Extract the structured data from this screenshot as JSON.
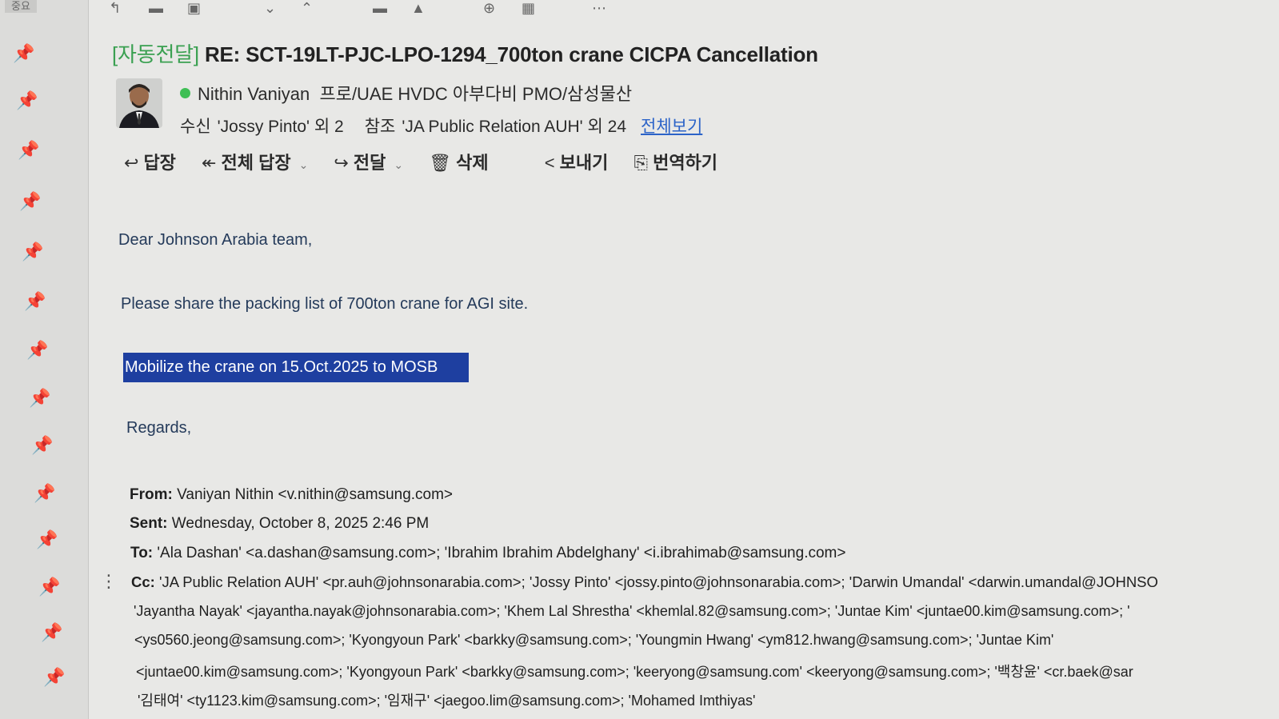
{
  "sidebar": {
    "top_label": "중요",
    "pin_count": 14
  },
  "toolbar_top": {
    "icons": [
      "back-arrow-icon",
      "archive-icon",
      "move-icon",
      "dropdown-icon",
      "up-icon",
      "mail-icon",
      "bell-icon",
      "zoom-icon",
      "grid-icon",
      "more-icon"
    ]
  },
  "email": {
    "subject_tag": "[자동전달]",
    "subject": "RE: SCT-19LT-PJC-LPO-1294_700ton crane CICPA Cancellation",
    "sender": "Nithin Vaniyan",
    "sender_org": "프로/UAE HVDC 아부다비 PMO/삼성물산",
    "to_label": "수신",
    "to_value": "'Jossy Pinto' 외 2",
    "cc_label": "참조",
    "cc_value": "'JA Public Relation AUH' 외 24",
    "view_all": "전체보기"
  },
  "actions": {
    "reply": "답장",
    "reply_all": "전체 답장",
    "forward": "전달",
    "delete": "삭제",
    "share": "보내기",
    "translate": "번역하기"
  },
  "body": {
    "greeting": "Dear Johnson Arabia team,",
    "line1": "Please share the packing list of 700ton crane for AGI site.",
    "highlight": "Mobilize the crane on 15.Oct.2025 to MOSB",
    "regards": "Regards,"
  },
  "quoted": {
    "from_label": "From:",
    "from_value": "Vaniyan Nithin <v.nithin@samsung.com>",
    "sent_label": "Sent:",
    "sent_value": "Wednesday, October 8, 2025 2:46 PM",
    "to_label": "To:",
    "to_value": "'Ala Dashan' <a.dashan@samsung.com>; 'Ibrahim Ibrahim Abdelghany' <i.ibrahimab@samsung.com>",
    "cc_label": "Cc:",
    "cc_line1": "'JA Public Relation AUH' <pr.auh@johnsonarabia.com>; 'Jossy Pinto' <jossy.pinto@johnsonarabia.com>; 'Darwin Umandal' <darwin.umandal@JOHNSO",
    "cc_line2": "'Jayantha Nayak' <jayantha.nayak@johnsonarabia.com>; 'Khem Lal Shrestha' <khemlal.82@samsung.com>; 'Juntae Kim' <juntae00.kim@samsung.com>; '",
    "cc_line3": "<ys0560.jeong@samsung.com>; 'Kyongyoun Park' <barkky@samsung.com>; 'Youngmin Hwang' <ym812.hwang@samsung.com>; 'Juntae Kim'",
    "cc_line4": "<juntae00.kim@samsung.com>; 'Kyongyoun Park' <barkky@samsung.com>; 'keeryong@samsung.com' <keeryong@samsung.com>; '백창윤' <cr.baek@sar",
    "cc_line5": "'김태여' <ty1123.kim@samsung.com>; '임재구' <jaegoo.lim@samsung.com>; 'Mohamed Imthiyas'"
  }
}
